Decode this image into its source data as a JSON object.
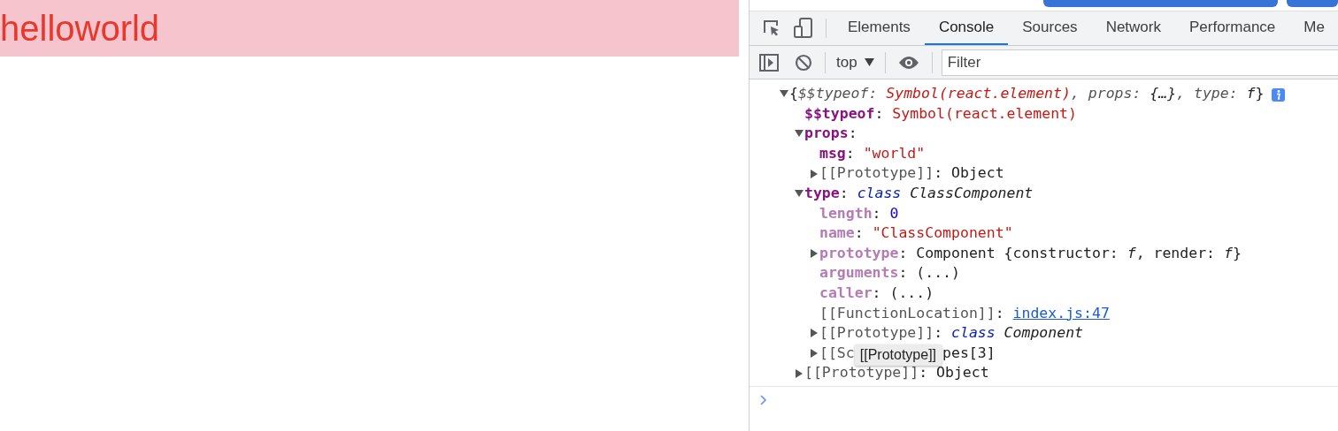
{
  "page": {
    "heading": "helloworld"
  },
  "devtools": {
    "tabs": [
      {
        "label": "Elements",
        "selected": false
      },
      {
        "label": "Console",
        "selected": true
      },
      {
        "label": "Sources",
        "selected": false
      },
      {
        "label": "Network",
        "selected": false
      },
      {
        "label": "Performance",
        "selected": false
      },
      {
        "label": "Me",
        "selected": false
      }
    ],
    "context": "top",
    "filter": {
      "placeholder": "Filter"
    },
    "tooltip": {
      "text": "[[Prototype]]"
    },
    "entries": [
      {
        "expanded": true,
        "info": true,
        "parts": [
          {
            "kind": "plain",
            "text": "{"
          },
          {
            "kind": "preview-key",
            "text": "$$typeof: "
          },
          {
            "kind": "preview-string",
            "text": "Symbol(react.element)"
          },
          {
            "kind": "preview-key",
            "text": ", props: "
          },
          {
            "kind": "preview-plain",
            "text": "{…}"
          },
          {
            "kind": "preview-key",
            "text": ", type: "
          },
          {
            "kind": "preview-plain",
            "text": "f"
          },
          {
            "kind": "plain",
            "text": "}"
          }
        ],
        "children": [
          {
            "parts": [
              {
                "kind": "key",
                "text": "$$typeof"
              },
              {
                "kind": "plain",
                "text": ": "
              },
              {
                "kind": "string",
                "text": "Symbol(react.element)"
              }
            ]
          },
          {
            "expanded": true,
            "parts": [
              {
                "kind": "key",
                "text": "props"
              },
              {
                "kind": "plain",
                "text": ":"
              }
            ],
            "children": [
              {
                "parts": [
                  {
                    "kind": "key",
                    "text": "msg"
                  },
                  {
                    "kind": "plain",
                    "text": ": "
                  },
                  {
                    "kind": "string",
                    "text": "\"world\""
                  }
                ]
              },
              {
                "expanded": false,
                "parts": [
                  {
                    "kind": "internal",
                    "text": "[[Prototype]]"
                  },
                  {
                    "kind": "plain",
                    "text": ": Object"
                  }
                ]
              }
            ]
          },
          {
            "expanded": true,
            "parts": [
              {
                "kind": "key",
                "text": "type"
              },
              {
                "kind": "plain",
                "text": ": "
              },
              {
                "kind": "keyword",
                "text": "class"
              },
              {
                "kind": "name",
                "text": " ClassComponent"
              }
            ],
            "children": [
              {
                "parts": [
                  {
                    "kind": "key-dim",
                    "text": "length"
                  },
                  {
                    "kind": "plain",
                    "text": ": "
                  },
                  {
                    "kind": "number",
                    "text": "0"
                  }
                ]
              },
              {
                "parts": [
                  {
                    "kind": "key-dim",
                    "text": "name"
                  },
                  {
                    "kind": "plain",
                    "text": ": "
                  },
                  {
                    "kind": "string",
                    "text": "\"ClassComponent\""
                  }
                ]
              },
              {
                "expanded": false,
                "parts": [
                  {
                    "kind": "key-dim",
                    "text": "prototype"
                  },
                  {
                    "kind": "plain",
                    "text": ": Component {constructor: "
                  },
                  {
                    "kind": "name",
                    "text": "f"
                  },
                  {
                    "kind": "plain",
                    "text": ", render: "
                  },
                  {
                    "kind": "name",
                    "text": "f"
                  },
                  {
                    "kind": "plain",
                    "text": "}"
                  }
                ]
              },
              {
                "parts": [
                  {
                    "kind": "key-dim",
                    "text": "arguments"
                  },
                  {
                    "kind": "plain",
                    "text": ": (...)"
                  }
                ]
              },
              {
                "parts": [
                  {
                    "kind": "key-dim",
                    "text": "caller"
                  },
                  {
                    "kind": "plain",
                    "text": ": (...)"
                  }
                ]
              },
              {
                "parts": [
                  {
                    "kind": "internal",
                    "text": "[[FunctionLocation]]"
                  },
                  {
                    "kind": "plain",
                    "text": ": "
                  },
                  {
                    "kind": "link",
                    "text": "index.js:47"
                  }
                ]
              },
              {
                "expanded": false,
                "parts": [
                  {
                    "kind": "internal",
                    "text": "[[Prototype]]"
                  },
                  {
                    "kind": "plain",
                    "text": ": "
                  },
                  {
                    "kind": "keyword",
                    "text": "class"
                  },
                  {
                    "kind": "name",
                    "text": " Component"
                  }
                ]
              },
              {
                "expanded": false,
                "parts": [
                  {
                    "kind": "internal",
                    "text": "[[Sc"
                  },
                  {
                    "kind": "tooltip"
                  },
                  {
                    "kind": "plain",
                    "text": "pes[3]"
                  }
                ]
              }
            ]
          },
          {
            "expanded": false,
            "parts": [
              {
                "kind": "internal",
                "text": "[[Prototype]]"
              },
              {
                "kind": "plain",
                "text": ": Object"
              }
            ]
          }
        ]
      }
    ]
  }
}
